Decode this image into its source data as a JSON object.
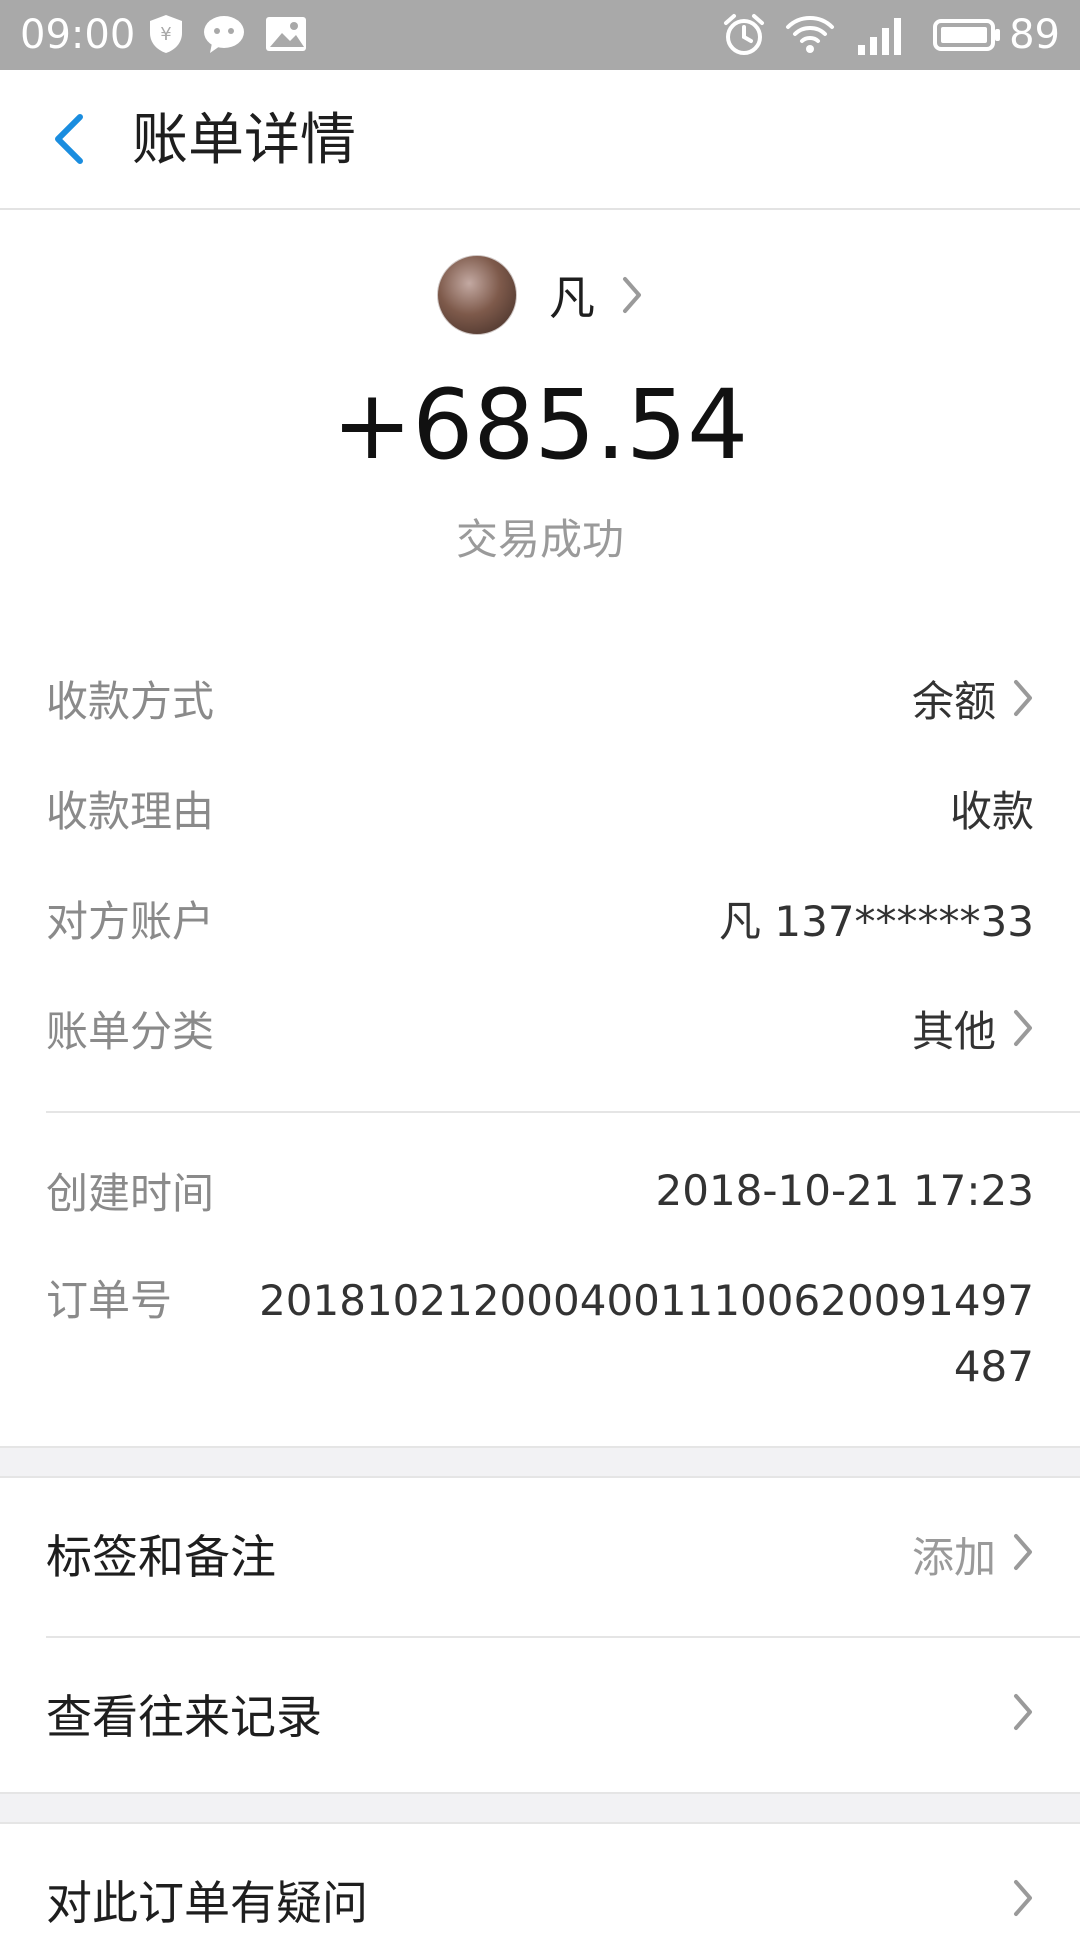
{
  "status_bar": {
    "time": "09:00",
    "battery": "89",
    "icons": [
      "shield-yen-icon",
      "chat-icon",
      "image-icon",
      "alarm-icon",
      "wifi-icon",
      "signal-icon",
      "battery-icon"
    ]
  },
  "header": {
    "title": "账单详情",
    "back_icon": "chevron-left-icon"
  },
  "payer": {
    "name": "凡"
  },
  "amount": "+685.54",
  "status_text": "交易成功",
  "details": [
    {
      "label": "收款方式",
      "value": "余额",
      "has_arrow": true
    },
    {
      "label": "收款理由",
      "value": "收款",
      "has_arrow": false
    },
    {
      "label": "对方账户",
      "value": "凡 137******33",
      "has_arrow": false
    },
    {
      "label": "账单分类",
      "value": "其他",
      "has_arrow": true
    }
  ],
  "created": {
    "label": "创建时间",
    "value": "2018-10-21 17:23"
  },
  "order": {
    "label": "订单号",
    "value": "2018102120004001110062009149748​7"
  },
  "actions": {
    "tags": {
      "label": "标签和备注",
      "hint": "添加"
    },
    "history": {
      "label": "查看往来记录"
    },
    "question": {
      "label": "对此订单有疑问"
    }
  },
  "colors": {
    "accent": "#1a8ddf",
    "status_bar": "#a9a9a9",
    "muted_text": "#8a8a8a",
    "separator_band": "#f2f2f4"
  }
}
